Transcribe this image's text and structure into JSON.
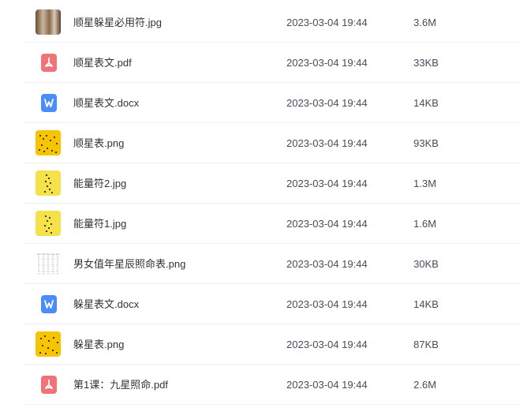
{
  "files": [
    {
      "name": "顺星躲星必用符.jpg",
      "date": "2023-03-04 19:44",
      "size": "3.6M",
      "icon": "photo-icon"
    },
    {
      "name": "顺星表文.pdf",
      "date": "2023-03-04 19:44",
      "size": "33KB",
      "icon": "pdf-icon"
    },
    {
      "name": "顺星表文.docx",
      "date": "2023-03-04 19:44",
      "size": "14KB",
      "icon": "word-doc-icon"
    },
    {
      "name": "顺星表.png",
      "date": "2023-03-04 19:44",
      "size": "93KB",
      "icon": "image-icon"
    },
    {
      "name": "能量符2.jpg",
      "date": "2023-03-04 19:44",
      "size": "1.3M",
      "icon": "photo-icon"
    },
    {
      "name": "能量符1.jpg",
      "date": "2023-03-04 19:44",
      "size": "1.6M",
      "icon": "photo-icon"
    },
    {
      "name": "男女值年星辰照命表.png",
      "date": "2023-03-04 19:44",
      "size": "30KB",
      "icon": "image-icon"
    },
    {
      "name": "躲星表文.docx",
      "date": "2023-03-04 19:44",
      "size": "14KB",
      "icon": "word-doc-icon"
    },
    {
      "name": "躲星表.png",
      "date": "2023-03-04 19:44",
      "size": "87KB",
      "icon": "image-icon"
    },
    {
      "name": "第1课：九星照命.pdf",
      "date": "2023-03-04 19:44",
      "size": "2.6M",
      "icon": "pdf-icon"
    }
  ],
  "colors": {
    "pdf": "#f0737a",
    "word": "#4a8df8",
    "text": "#333333",
    "meta": "#454d5a"
  }
}
